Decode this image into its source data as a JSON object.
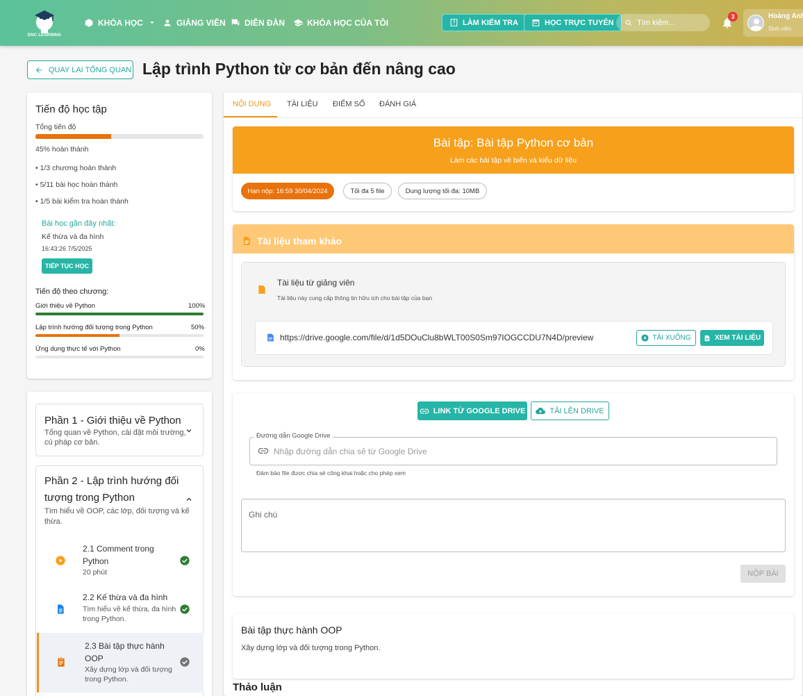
{
  "header": {
    "logo_text": "DNC LEARNING",
    "nav": [
      {
        "label": "KHÓA HỌC",
        "icon": "box-icon"
      },
      {
        "label": "GIẢNG VIÊN",
        "icon": "person-icon"
      },
      {
        "label": "DIỄN ĐÀN",
        "icon": "forum-icon"
      },
      {
        "label": "KHÓA HỌC CỦA TÔI",
        "icon": "school-icon"
      }
    ],
    "btn_quiz": "LÀM KIỂM TRA",
    "btn_online": "HỌC TRỰC TUYẾN",
    "search_placeholder": "Tìm kiếm...",
    "notif_count": "3",
    "user_name": "Hoàng Anh",
    "user_role": "Sinh viên"
  },
  "title_row": {
    "back_label": "QUAY LẠI TỔNG QUAN",
    "title": "Lập trình Python từ cơ bản đến nâng cao"
  },
  "progress": {
    "heading": "Tiến độ học tập",
    "total_label": "Tổng tiến độ",
    "total_fraction": 0.45,
    "total_text": "45% hoàn thành",
    "stats": [
      "• 1/3 chương hoàn thành",
      "• 5/11 bài học hoàn thành",
      "• 1/5 bài kiểm tra hoàn thành"
    ],
    "recent_label": "Bài học gần đây nhất:",
    "recent_lesson": "Kế thừa và đa hình",
    "recent_time": "16:43:26 7/5/2025",
    "continue_label": "TIẾP TỤC HỌC",
    "chapter_heading": "Tiến độ theo chương:",
    "chapters": [
      {
        "name": "Giới thiệu về Python",
        "percent": "100%",
        "fraction": 1.0,
        "color": "#2e7d32"
      },
      {
        "name": "Lập trình hướng đối tượng trong Python",
        "percent": "50%",
        "fraction": 0.5,
        "color": "#e8720c"
      },
      {
        "name": "Ứng dụng thực tế với Python",
        "percent": "0%",
        "fraction": 0.0,
        "color": "#e8720c"
      }
    ]
  },
  "sections": [
    {
      "title": "Phần 1 - Giới thiệu về Python",
      "desc_lines": [
        "Tổng quan về Python, cài đặt môi trường,",
        "cú pháp cơ bản."
      ]
    },
    {
      "title_lines": [
        "Phần 2 - Lập trình hướng đối",
        "tượng trong Python"
      ],
      "desc_lines": [
        "Tìm hiểu về OOP, các lớp, đối tượng và kế",
        "thừa."
      ]
    }
  ],
  "lessons": [
    {
      "title_lines": [
        "2.1 Comment trong",
        "Python"
      ],
      "desc_lines": [
        "20 phút"
      ]
    },
    {
      "title_lines": [
        "2.2 Kế thừa và đa hình"
      ],
      "desc_lines": [
        "Tìm hiểu về kế thừa, đa hình",
        "trong Python."
      ]
    },
    {
      "title_lines": [
        "2.3 Bài tập thực hành",
        "OOP"
      ],
      "desc_lines": [
        "Xây dựng lớp và đối tượng",
        "trong Python."
      ]
    }
  ],
  "tabs": [
    "NỘI DUNG",
    "TÀI LIỆU",
    "ĐIỂM SỐ",
    "ĐÁNH GIÁ"
  ],
  "assignment": {
    "title": "Bài tập: Bài tập Python cơ bản",
    "subtitle": "Làm các bài tập về biến và kiểu dữ liệu",
    "deadline": "Hạn nộp: 16:59 30/04/2024",
    "max_files": "Tối đa 5 file",
    "max_size": "Dung lượng tối đa: 10MB"
  },
  "reference": {
    "heading": "Tài liệu tham khảo",
    "from_teacher": "Tài liệu từ giảng viên",
    "desc": "Tài liệu này cung cấp thông tin hữu ích cho bài tập của bạn",
    "url": "https://drive.google.com/file/d/1d5DOuClu8bWLT00S0Sm97IOGCCDU7N4D/preview",
    "download_label": "TẢI XUỐNG",
    "view_label": "XEM TÀI LIỆU"
  },
  "submission": {
    "tab_link": "LINK TỪ GOOGLE DRIVE",
    "tab_upload": "TẢI LÊN DRIVE",
    "drive_label": "Đường dẫn Google Drive",
    "drive_placeholder": "Nhập đường dẫn chia sẻ từ Google Drive",
    "drive_helper": "Đảm bảo file được chia sẻ công khai hoặc cho phép xem",
    "note_placeholder": "Ghi chú",
    "submit_label": "NỘP BÀI"
  },
  "oop": {
    "title": "Bài tập thực hành OOP",
    "desc": "Xây dựng lớp và đối tượng trong Python."
  },
  "discussion_label": "Thảo luận"
}
